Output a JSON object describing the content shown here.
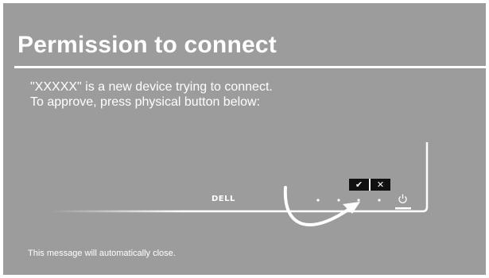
{
  "dialog": {
    "title": "Permission to connect",
    "message_line1": "\"XXXXX\" is a new device trying to connect.",
    "message_line2": "To approve, press physical button below:",
    "footer": "This message will automatically close."
  },
  "illustration": {
    "brand_logo": "DELL",
    "approve_icon": "check-icon",
    "reject_icon": "close-icon",
    "power_icon": "power-icon"
  },
  "colors": {
    "background": "#9c9c9c",
    "text": "#ffffff",
    "button_box": "#111111"
  }
}
